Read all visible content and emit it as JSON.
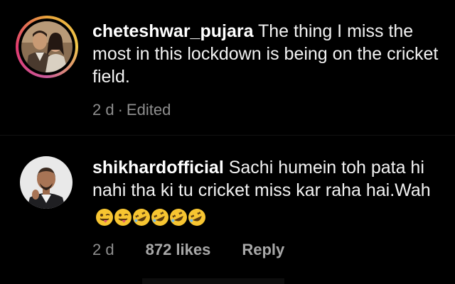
{
  "comments": [
    {
      "username": "cheteshwar_pujara",
      "text": " The thing I miss the most in this lockdown is being on the cricket field.",
      "time": "2 d",
      "separator": "·",
      "status": "Edited",
      "has_story_ring": true
    },
    {
      "username": "shikhardofficial",
      "text": " Sachi humein toh pata hi nahi tha ki tu cricket miss kar raha hai.Wah",
      "emojis": [
        "winking-tongue-emoji",
        "winking-tongue-emoji",
        "rofl-emoji",
        "rofl-emoji",
        "rofl-emoji",
        "rofl-emoji"
      ],
      "time": "2 d",
      "likes": "872 likes",
      "reply_label": "Reply",
      "has_story_ring": false
    }
  ],
  "colors": {
    "background": "#000000",
    "text": "#f2f2f2",
    "meta": "#8e8e8e",
    "ring_start": "#e8a43a",
    "ring_end": "#e23a6f",
    "emoji_yellow": "#f7c531"
  }
}
